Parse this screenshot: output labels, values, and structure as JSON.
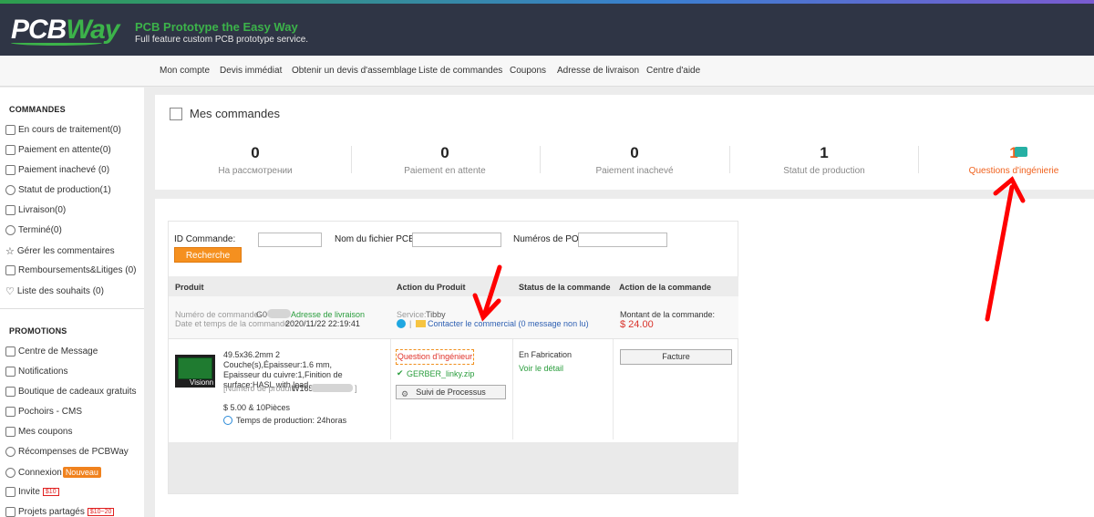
{
  "header": {
    "logo_main": "PCB",
    "logo_accent": "Way",
    "tagline": "PCB Prototype the Easy Way",
    "subtagline": "Full feature custom PCB prototype service."
  },
  "nav": [
    "Mon compte",
    "Devis immédiat",
    "Obtenir un devis d'assemblage",
    "Liste de commandes",
    "Coupons",
    "Adresse de livraison",
    "Centre d'aide"
  ],
  "sidebar": {
    "commandes_title": "COMMANDES",
    "commandes": [
      {
        "label": "En cours de traitement(0)",
        "icon": "list-icon"
      },
      {
        "label": "Paiement en attente(0)",
        "icon": "card-icon"
      },
      {
        "label": "Paiement inachevé (0)",
        "icon": "doc-icon"
      },
      {
        "label": "Statut de production(1)",
        "icon": "gear-icon"
      },
      {
        "label": "Livraison(0)",
        "icon": "truck-icon"
      },
      {
        "label": "Terminé(0)",
        "icon": "check-circle-icon"
      },
      {
        "label": "Gérer les commentaires",
        "icon": "star-icon"
      },
      {
        "label": "Remboursements&Litiges (0)",
        "icon": "refund-icon"
      },
      {
        "label": "Liste des souhaits (0)",
        "icon": "heart-icon"
      }
    ],
    "promotions_title": "PROMOTIONS",
    "promotions": [
      {
        "label": "Centre de Message",
        "icon": "message-icon"
      },
      {
        "label": "Notifications",
        "icon": "chat-icon"
      },
      {
        "label": "Boutique de cadeaux gratuits",
        "icon": "gift-icon"
      },
      {
        "label": "Pochoirs - CMS",
        "icon": "stencil-icon"
      },
      {
        "label": "Mes coupons",
        "icon": "coupon-icon"
      },
      {
        "label": "Récompenses de PCBWay",
        "icon": "reward-icon"
      },
      {
        "label": "Connexion",
        "icon": "signin-icon",
        "tag": "Nouveau"
      },
      {
        "label": "Invite",
        "icon": "invite-icon",
        "tag_red": "$10"
      },
      {
        "label": "Projets partagés",
        "icon": "shared-icon",
        "tag_red": "$10~20"
      }
    ]
  },
  "orders_panel": {
    "title": "Mes commandes",
    "stats": [
      {
        "num": "0",
        "label": "На рассмотрении"
      },
      {
        "num": "0",
        "label": "Paiement en attente"
      },
      {
        "num": "0",
        "label": "Paiement inachevé"
      },
      {
        "num": "1",
        "label": "Statut de production"
      },
      {
        "num": "1",
        "label": "Questions d'ingénierie"
      }
    ]
  },
  "search": {
    "id_label": "ID Commande:",
    "file_label": "Nom du fichier PCB:",
    "po_label": "Numéros de PO:",
    "button": "Recherche"
  },
  "table": {
    "headers": [
      "Produit",
      "Action du Produit",
      "Status de la commande",
      "Action de la commande"
    ],
    "order_number_label": "Numéro de commande:",
    "order_number_value": "G0",
    "address_link": "Adresse de livraison",
    "date_label": "Date et temps de la commande :",
    "date_value": "2020/11/22 22:19:41",
    "service_label": "Service:",
    "service_value": "Tibby",
    "contact_link": "Contacter le commercial (0 message non lu)",
    "amount_label": "Montant de la commande:",
    "amount_value": "$ 24.00",
    "product_desc": "49.5x36.2mm 2 Couche(s),Épaisseur:1.6 mm, Epaisseur du cuivre:1,Finition de surface:HASL with lead",
    "product_number_label": "[Numéro de produit:",
    "product_number_value": "W165",
    "product_number_end": "]",
    "price": "$ 5.00 & 10Pièces",
    "production_time": "Temps de production: 24horas",
    "image_caption": "Visionn",
    "question_tag": "Question d'ingénieur",
    "gerber_file": "GERBER_linky.zip",
    "process_button": "Suivi de Processus",
    "status": "En Fabrication",
    "detail_link": "Voir le détail",
    "invoice_button": "Facture"
  },
  "colors": {
    "accent": "#f0621e",
    "brand_green": "#3cb34a",
    "header_bg": "#2f3545",
    "annotation_red": "#ff0000"
  }
}
